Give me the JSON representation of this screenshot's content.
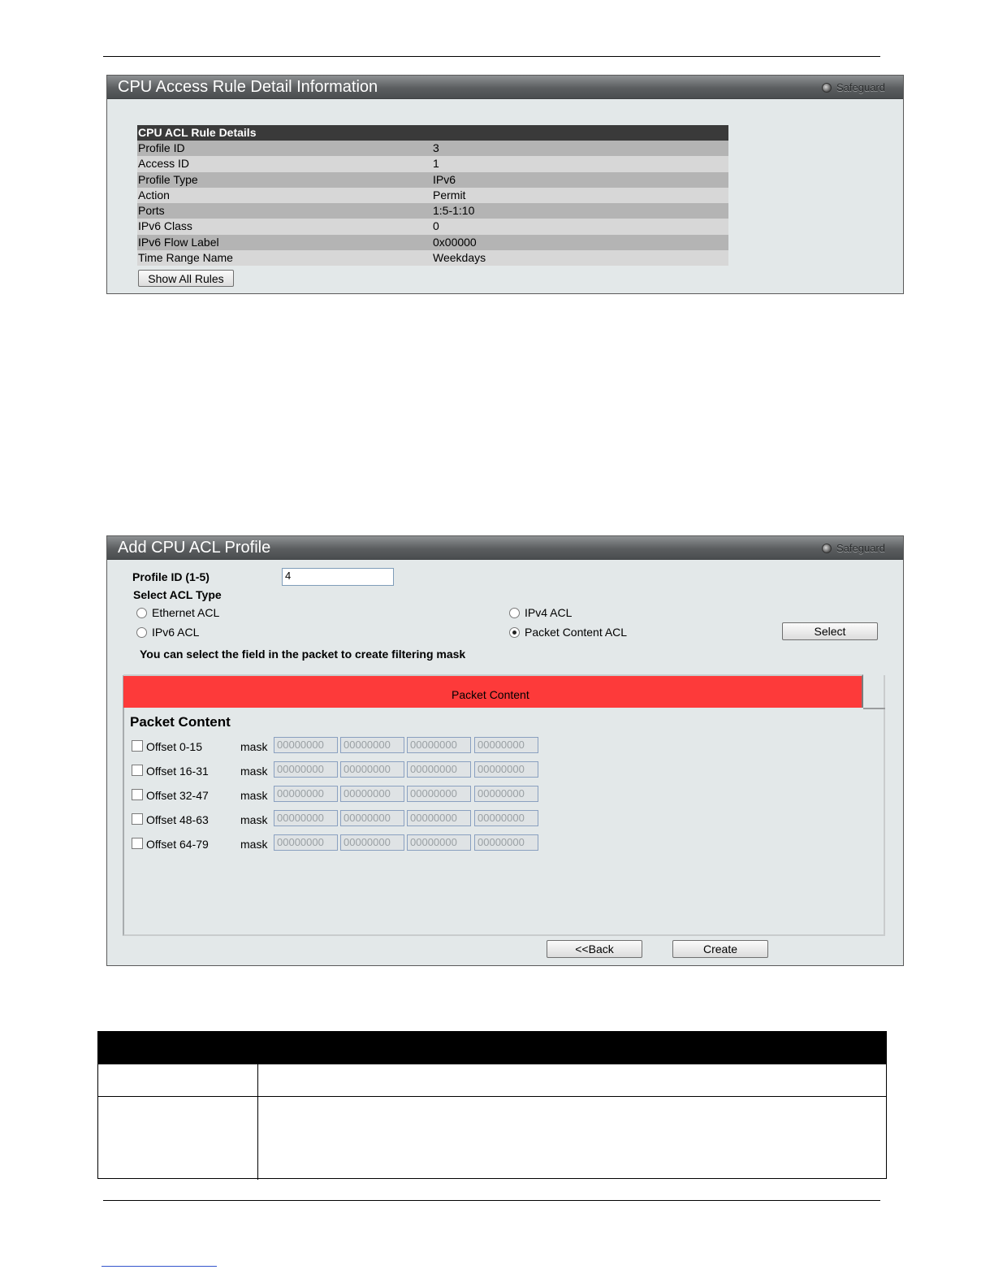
{
  "rule_detail": {
    "title": "CPU Access Rule Detail Information",
    "safeguard": "Safeguard",
    "table_header": "CPU ACL Rule Details",
    "rows": [
      {
        "label": "Profile ID",
        "value": "3"
      },
      {
        "label": "Access ID",
        "value": "1"
      },
      {
        "label": "Profile Type",
        "value": "IPv6"
      },
      {
        "label": "Action",
        "value": "Permit"
      },
      {
        "label": "Ports",
        "value": "1:5-1:10"
      },
      {
        "label": "IPv6 Class",
        "value": "0"
      },
      {
        "label": "IPv6 Flow Label",
        "value": "0x00000"
      },
      {
        "label": "Time Range Name",
        "value": "Weekdays"
      }
    ],
    "show_all_label": "Show All Rules"
  },
  "add_profile": {
    "title": "Add CPU ACL Profile",
    "safeguard": "Safeguard",
    "profile_id_label": "Profile ID (1-5)",
    "profile_id_value": "4",
    "select_acl_type_label": "Select ACL Type",
    "acl_types": {
      "ethernet": "Ethernet ACL",
      "ipv4": "IPv4 ACL",
      "ipv6": "IPv6 ACL",
      "packet_content": "Packet Content ACL"
    },
    "selected_acl_type": "Packet Content ACL",
    "select_button": "Select",
    "hint": "You can select the field in the packet to create filtering mask",
    "tab_label": "Packet Content",
    "section_title": "Packet Content",
    "mask_label": "mask",
    "offsets": [
      {
        "label": "Offset 0-15",
        "masks": [
          "00000000",
          "00000000",
          "00000000",
          "00000000"
        ]
      },
      {
        "label": "Offset 16-31",
        "masks": [
          "00000000",
          "00000000",
          "00000000",
          "00000000"
        ]
      },
      {
        "label": "Offset 32-47",
        "masks": [
          "00000000",
          "00000000",
          "00000000",
          "00000000"
        ]
      },
      {
        "label": "Offset 48-63",
        "masks": [
          "00000000",
          "00000000",
          "00000000",
          "00000000"
        ]
      },
      {
        "label": "Offset 64-79",
        "masks": [
          "00000000",
          "00000000",
          "00000000",
          "00000000"
        ]
      }
    ],
    "back_button": "<<Back",
    "create_button": "Create"
  }
}
